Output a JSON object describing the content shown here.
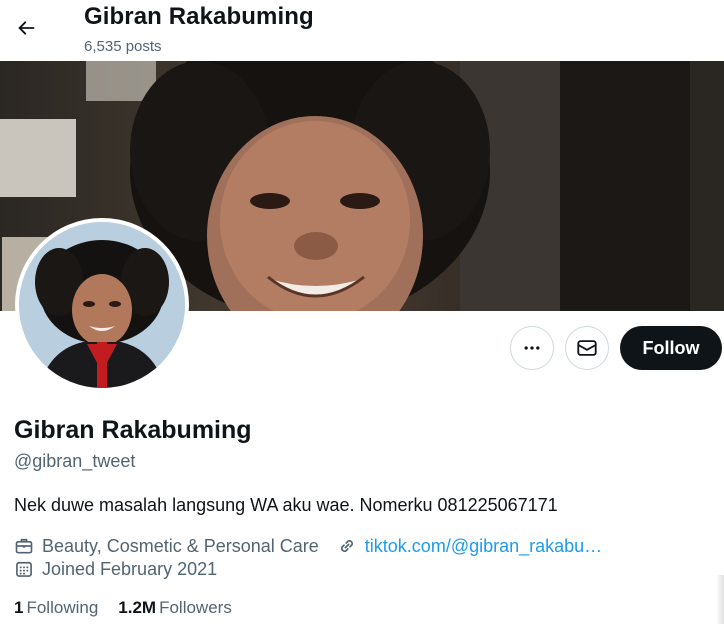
{
  "header": {
    "title": "Gibran Rakabuming",
    "post_count": "6,535 posts",
    "back_icon": "arrow-left-icon"
  },
  "profile": {
    "name": "Gibran Rakabuming",
    "handle": "@gibran_tweet",
    "bio": "Nek duwe masalah langsung WA aku wae. Nomerku 081225067171",
    "category": "Beauty, Cosmetic & Personal Care",
    "link": "tiktok.com/@gibran_rakabu…",
    "joined": "Joined February 2021"
  },
  "actions": {
    "more_icon": "more-icon",
    "message_icon": "envelope-icon",
    "follow_label": "Follow"
  },
  "stats": {
    "following_count": "1",
    "following_label": "Following",
    "followers_count": "1.2M",
    "followers_label": "Followers"
  },
  "colors": {
    "text_primary": "#0f1419",
    "text_secondary": "#536471",
    "link": "#1d9bf0",
    "follow_bg": "#0f1419",
    "border": "#cfd9de"
  }
}
